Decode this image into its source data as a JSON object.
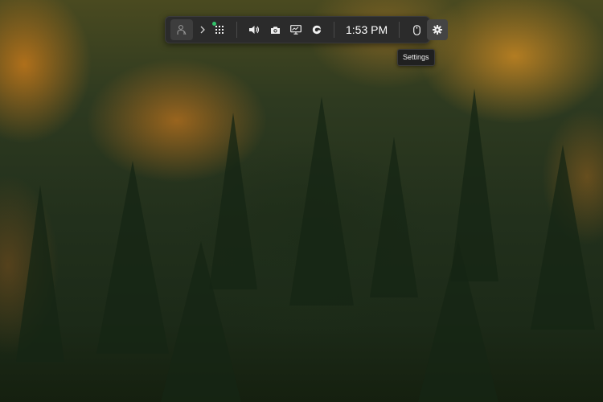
{
  "taskbar": {
    "time": "1:53 PM",
    "status_color": "#31c46b",
    "buttons": [
      {
        "name": "user-thumbnail",
        "icon": "person-icon"
      },
      {
        "name": "expand",
        "icon": "chevron-right-icon"
      },
      {
        "name": "app-grid",
        "icon": "grid-icon"
      },
      {
        "name": "volume",
        "icon": "speaker-icon"
      },
      {
        "name": "screenshot",
        "icon": "camera-icon"
      },
      {
        "name": "display",
        "icon": "monitor-icon"
      },
      {
        "name": "edge",
        "icon": "edge-icon"
      },
      {
        "name": "mouse",
        "icon": "mouse-icon"
      },
      {
        "name": "settings",
        "icon": "gear-icon"
      }
    ]
  },
  "tooltip": {
    "settings": "Settings"
  }
}
